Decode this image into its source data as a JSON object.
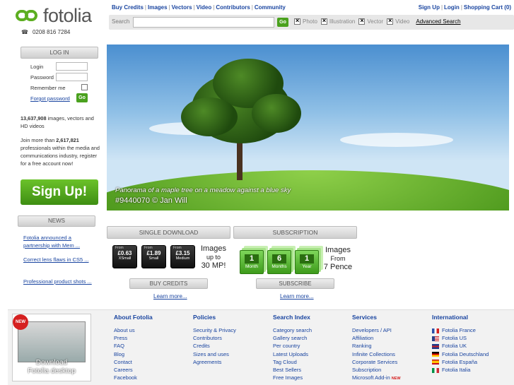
{
  "logo": {
    "text": "fotolia",
    "phone": "0208 816 7284",
    "icon": "phone-icon"
  },
  "topnav": [
    "Buy Credits",
    "Images",
    "Vectors",
    "Video",
    "Contributors",
    "Community"
  ],
  "rightnav": [
    "Sign Up",
    "Login",
    "Shopping Cart (0)"
  ],
  "search": {
    "label": "Search",
    "placeholder": "",
    "go": "Go",
    "filters": [
      {
        "label": "Photo",
        "checked": true
      },
      {
        "label": "Illustration",
        "checked": true
      },
      {
        "label": "Vector",
        "checked": true
      },
      {
        "label": "Video",
        "checked": true
      }
    ],
    "advanced": "Advanced Search"
  },
  "login": {
    "title": "LOG IN",
    "login_label": "Login",
    "password_label": "Password",
    "remember_label": "Remember me",
    "forgot": "Forgot password",
    "go": "Go"
  },
  "stats": {
    "count": "13,637,908",
    "count_text": " images, vectors and HD videos",
    "join_pre": "Join more than ",
    "members": "2,617,821",
    "join_post": " professionals within the media and communications industry, register for a free account now!"
  },
  "signup_label": "Sign Up!",
  "news": {
    "title": "NEWS",
    "items": [
      "Fotolia announced a partnership with Mem ...",
      "Correct lens flaws in CS5 ...",
      "Professional product shots ..."
    ]
  },
  "hero": {
    "caption": "Panorama of a maple tree on a meadow against a blue sky",
    "credit": "#9440070  © Jan Will"
  },
  "single": {
    "title": "SINGLE DOWNLOAD",
    "tiles": [
      {
        "from": "From",
        "price": "£0.63",
        "size": "XSmall"
      },
      {
        "from": "From",
        "price": "£1.89",
        "size": "Small"
      },
      {
        "from": "From",
        "price": "£3.15",
        "size": "Medium"
      }
    ],
    "tagline": [
      "Images",
      "up to",
      "30 MP!"
    ],
    "button": "BUY CREDITS",
    "learn": "Learn more..."
  },
  "subscription": {
    "title": "SUBSCRIPTION",
    "tiles": [
      {
        "n": "1",
        "unit": "Month"
      },
      {
        "n": "6",
        "unit": "Months"
      },
      {
        "n": "1",
        "unit": "Year"
      }
    ],
    "tagline": [
      "Images",
      "From",
      "7 Pence"
    ],
    "button": "SUBSCRIBE",
    "learn": "Learn more..."
  },
  "promo": {
    "badge": "NEW",
    "line1": "Download",
    "line2": "Fotolia desktop"
  },
  "footer": {
    "about": {
      "title": "About Fotolia",
      "items": [
        "About us",
        "Press",
        "FAQ",
        "Blog",
        "Contact",
        "Careers",
        "Facebook"
      ]
    },
    "policies": {
      "title": "Policies",
      "items": [
        "Security & Privacy",
        "Contributors",
        "Credits",
        "Sizes and uses",
        "Agreements"
      ]
    },
    "search_index": {
      "title": "Search Index",
      "items": [
        "Category search",
        "Gallery search",
        "Per country",
        "Latest Uploads",
        "Tag Cloud",
        "Best Sellers",
        "Free Images"
      ]
    },
    "services": {
      "title": "Services",
      "items": [
        "Developers / API",
        "Affiliation",
        "Ranking",
        "Infinite Collections",
        "Corporate Services",
        "Subscription",
        "Microsoft Add-in"
      ],
      "new_badge": "NEW"
    },
    "international": {
      "title": "International",
      "items": [
        {
          "label": "Fotolia France",
          "flag": "flag-france-icon",
          "colors": [
            "#2b4fa8",
            "#ffffff",
            "#d52020"
          ]
        },
        {
          "label": "Fotolia US",
          "flag": "flag-us-icon",
          "colors": [
            "#2b3f8a",
            "#ffffff",
            "#c8202a"
          ]
        },
        {
          "label": "Fotolia UK",
          "flag": "flag-uk-icon",
          "colors": [
            "#1f3a8a",
            "#ffffff",
            "#cc1c24"
          ]
        },
        {
          "label": "Fotolia Deutschland",
          "flag": "flag-germany-icon",
          "colors": [
            "#000000",
            "#dd0000",
            "#ffce00"
          ]
        },
        {
          "label": "Fotolia España",
          "flag": "flag-spain-icon",
          "colors": [
            "#c60b1e",
            "#ffc400",
            "#c60b1e"
          ]
        },
        {
          "label": "Fotolia Italia",
          "flag": "flag-italy-icon",
          "colors": [
            "#009246",
            "#ffffff",
            "#ce2b37"
          ]
        }
      ]
    }
  },
  "colors": {
    "brand_green": "#5cae20",
    "link_blue": "#1a45a0"
  }
}
